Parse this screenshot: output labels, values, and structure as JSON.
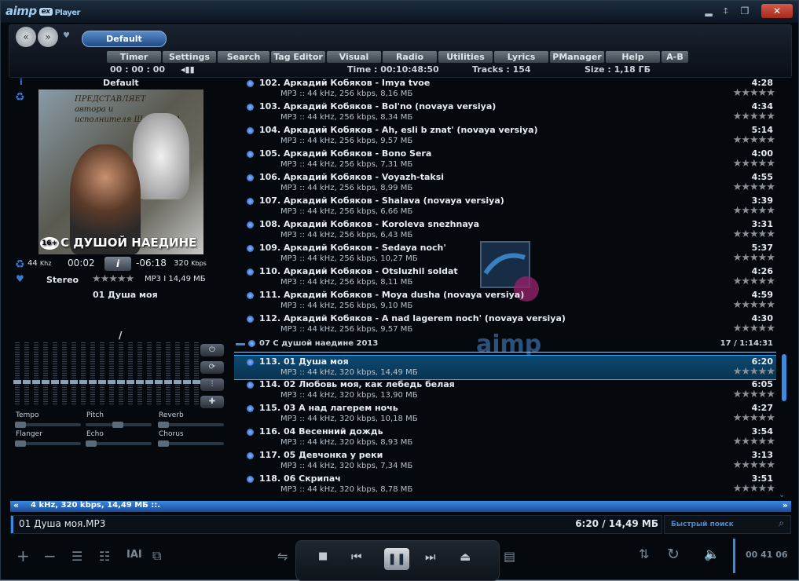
{
  "window": {
    "logo": "aimp",
    "logo_ex": "ex",
    "logo_sub": "Player",
    "buttons": [
      "▂",
      "⍏",
      "❐",
      "✕"
    ]
  },
  "topbar": {
    "preset": "Default",
    "tabs": [
      "Timer",
      "Settings",
      "Search",
      "Tag Editor",
      "Visual",
      "Radio",
      "Utilities",
      "Lyrics",
      "PManager",
      "Help",
      "A-B"
    ],
    "timer": "00 : 00 : 00",
    "time": "Time : 00:10:48:50",
    "tracks": "Tracks : 154",
    "size": "Size : 1,18 ГБ"
  },
  "left": {
    "header": "Default",
    "cover_text": [
      "ПРЕДСТАВЛЯЕТ",
      "автора и",
      "исполнителя ШАНСОНА"
    ],
    "cover_title": "С ДУШОЙ НАЕДИНЕ",
    "cover_age": "16+",
    "khz": "44",
    "khz_unit": "Khz",
    "elapsed": "00:02",
    "info_btn": "i",
    "remaining": "-06:18",
    "kbps": "320",
    "kbps_unit": "Kbps",
    "mode": "Stereo",
    "fileinfo": "MP3 I 14,49 МБ",
    "track": "01 Душа моя",
    "slash": "/",
    "fx": [
      "Tempo",
      "Pitch",
      "Reverb",
      "Flanger",
      "Echo",
      "Chorus"
    ],
    "icons": [
      "power-icon",
      "loop-icon",
      "equalizer-icon",
      "puzzle-icon"
    ]
  },
  "playlist": {
    "tracks": [
      {
        "n": "102.",
        "title": "Аркадий Кобяков - Imya tvoe",
        "info": "MP3 :: 44 kHz, 256 kbps, 8,16 МБ",
        "dur": "4:28"
      },
      {
        "n": "103.",
        "title": "Аркадий Кобяков - Bol'no (novaya versiya)",
        "info": "MP3 :: 44 kHz, 256 kbps, 8,34 МБ",
        "dur": "4:34"
      },
      {
        "n": "104.",
        "title": "Аркадий Кобяков - Ah, esli b znat' (novaya versiya)",
        "info": "MP3 :: 44 kHz, 256 kbps, 9,57 МБ",
        "dur": "5:14"
      },
      {
        "n": "105.",
        "title": "Аркадий Кобяков - Bono Sera",
        "info": "MP3 :: 44 kHz, 256 kbps, 7,31 МБ",
        "dur": "4:00"
      },
      {
        "n": "106.",
        "title": "Аркадий Кобяков - Voyazh-taksi",
        "info": "MP3 :: 44 kHz, 256 kbps, 8,99 МБ",
        "dur": "4:55"
      },
      {
        "n": "107.",
        "title": "Аркадий Кобяков - Shalava (novaya versiya)",
        "info": "MP3 :: 44 kHz, 256 kbps, 6,66 МБ",
        "dur": "3:39"
      },
      {
        "n": "108.",
        "title": "Аркадий Кобяков - Koroleva snezhnaya",
        "info": "MP3 :: 44 kHz, 256 kbps, 6,43 МБ",
        "dur": "3:31"
      },
      {
        "n": "109.",
        "title": "Аркадий Кобяков - Sedaya noch'",
        "info": "MP3 :: 44 kHz, 256 kbps, 10,27 МБ",
        "dur": "5:37"
      },
      {
        "n": "110.",
        "title": "Аркадий Кобяков - Otsluzhil soldat",
        "info": "MP3 :: 44 kHz, 256 kbps, 8,11 МБ",
        "dur": "4:26"
      },
      {
        "n": "111.",
        "title": "Аркадий Кобяков - Moya dusha (novaya versiya)",
        "info": "MP3 :: 44 kHz, 256 kbps, 9,10 МБ",
        "dur": "4:59"
      },
      {
        "n": "112.",
        "title": "Аркадий Кобяков - A nad lagerem noch' (novaya versiya)",
        "info": "MP3 :: 44 kHz, 256 kbps, 9,57 МБ",
        "dur": "4:30"
      }
    ],
    "group": {
      "title": "07 С душой наедине 2013",
      "info": "17 / 1:14:31"
    },
    "tracks2": [
      {
        "n": "113.",
        "title": "01 Душа моя",
        "info": "MP3 :: 44 kHz, 320 kbps, 14,49 МБ",
        "dur": "6:20"
      },
      {
        "n": "114.",
        "title": "02 Любовь моя, как лебедь белая",
        "info": "MP3 :: 44 kHz, 320 kbps, 13,90 МБ",
        "dur": "6:05"
      },
      {
        "n": "115.",
        "title": "03 А над лагерем ночь",
        "info": "MP3 :: 44 kHz, 320 kbps, 10,18 МБ",
        "dur": "4:27"
      },
      {
        "n": "116.",
        "title": "04 Весенний дождь",
        "info": "MP3 :: 44 kHz, 320 kbps, 8,93 МБ",
        "dur": "3:54"
      },
      {
        "n": "117.",
        "title": "05 Девчонка у реки",
        "info": "MP3 :: 44 kHz, 320 kbps, 7,34 МБ",
        "dur": "3:13"
      },
      {
        "n": "118.",
        "title": "06 Скрипач",
        "info": "MP3 :: 44 kHz, 320 kbps, 8,78 МБ",
        "dur": "3:51"
      }
    ],
    "stars": "★★★★★"
  },
  "status": "4 kHz, 320 kbps, 14,49 МБ ::.",
  "nowplaying": {
    "file": "01 Душа моя.MP3",
    "time": "6:20 / 14,49 МБ"
  },
  "search": {
    "placeholder": "Быстрый поиск"
  },
  "clock": "00 41 06",
  "colors": {
    "accent": "#3a8ae0",
    "selected": "#0c4a72",
    "background": "#05080c"
  }
}
